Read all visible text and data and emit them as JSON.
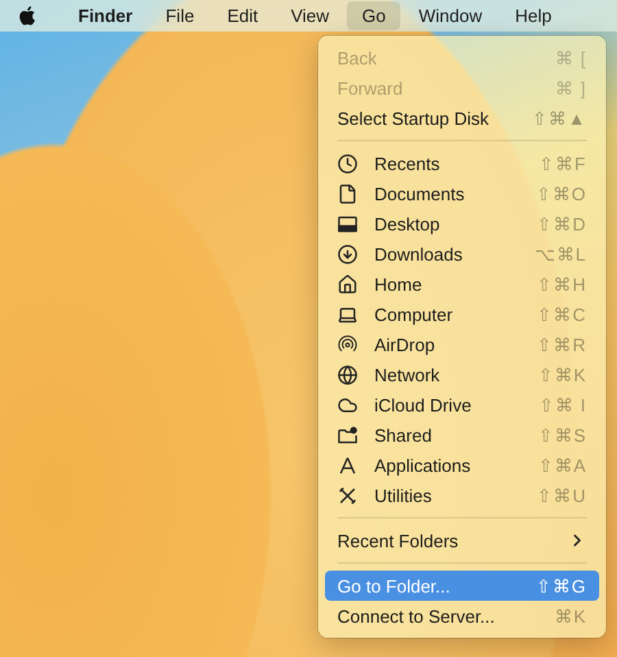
{
  "menubar": {
    "items": [
      {
        "label": "Finder",
        "kind": "app",
        "selected": false
      },
      {
        "label": "File",
        "kind": "menu",
        "selected": false
      },
      {
        "label": "Edit",
        "kind": "menu",
        "selected": false
      },
      {
        "label": "View",
        "kind": "menu",
        "selected": false
      },
      {
        "label": "Go",
        "kind": "menu",
        "selected": true
      },
      {
        "label": "Window",
        "kind": "menu",
        "selected": false
      },
      {
        "label": "Help",
        "kind": "menu",
        "selected": false
      }
    ]
  },
  "menu": {
    "sections": [
      [
        {
          "kind": "plain",
          "label": "Back",
          "shortcut": "⌘ [",
          "disabled": true,
          "selected": false
        },
        {
          "kind": "plain",
          "label": "Forward",
          "shortcut": "⌘ ]",
          "disabled": true,
          "selected": false
        },
        {
          "kind": "plain",
          "label": "Select Startup Disk",
          "shortcut": "⇧⌘▲",
          "disabled": false,
          "selected": false
        }
      ],
      [
        {
          "kind": "place",
          "label": "Recents",
          "shortcut": "⇧⌘F",
          "disabled": false,
          "selected": false
        },
        {
          "kind": "place",
          "label": "Documents",
          "shortcut": "⇧⌘O",
          "disabled": false,
          "selected": false
        },
        {
          "kind": "place",
          "label": "Desktop",
          "shortcut": "⇧⌘D",
          "disabled": false,
          "selected": false
        },
        {
          "kind": "place",
          "label": "Downloads",
          "shortcut": "⌥⌘L",
          "disabled": false,
          "selected": false
        },
        {
          "kind": "place",
          "label": "Home",
          "shortcut": "⇧⌘H",
          "disabled": false,
          "selected": false
        },
        {
          "kind": "place",
          "label": "Computer",
          "shortcut": "⇧⌘C",
          "disabled": false,
          "selected": false
        },
        {
          "kind": "place",
          "label": "AirDrop",
          "shortcut": "⇧⌘R",
          "disabled": false,
          "selected": false
        },
        {
          "kind": "place",
          "label": "Network",
          "shortcut": "⇧⌘K",
          "disabled": false,
          "selected": false
        },
        {
          "kind": "place",
          "label": "iCloud Drive",
          "shortcut": "⇧⌘ I",
          "disabled": false,
          "selected": false
        },
        {
          "kind": "place",
          "label": "Shared",
          "shortcut": "⇧⌘S",
          "disabled": false,
          "selected": false
        },
        {
          "kind": "place",
          "label": "Applications",
          "shortcut": "⇧⌘A",
          "disabled": false,
          "selected": false
        },
        {
          "kind": "place",
          "label": "Utilities",
          "shortcut": "⇧⌘U",
          "disabled": false,
          "selected": false
        }
      ],
      [
        {
          "kind": "submenu",
          "label": "Recent Folders",
          "disabled": false,
          "selected": false
        }
      ],
      [
        {
          "kind": "plain",
          "label": "Go to Folder...",
          "shortcut": "⇧⌘G",
          "disabled": false,
          "selected": true
        },
        {
          "kind": "plain",
          "label": "Connect to Server...",
          "shortcut": "⌘K",
          "disabled": false,
          "selected": false
        }
      ]
    ]
  }
}
